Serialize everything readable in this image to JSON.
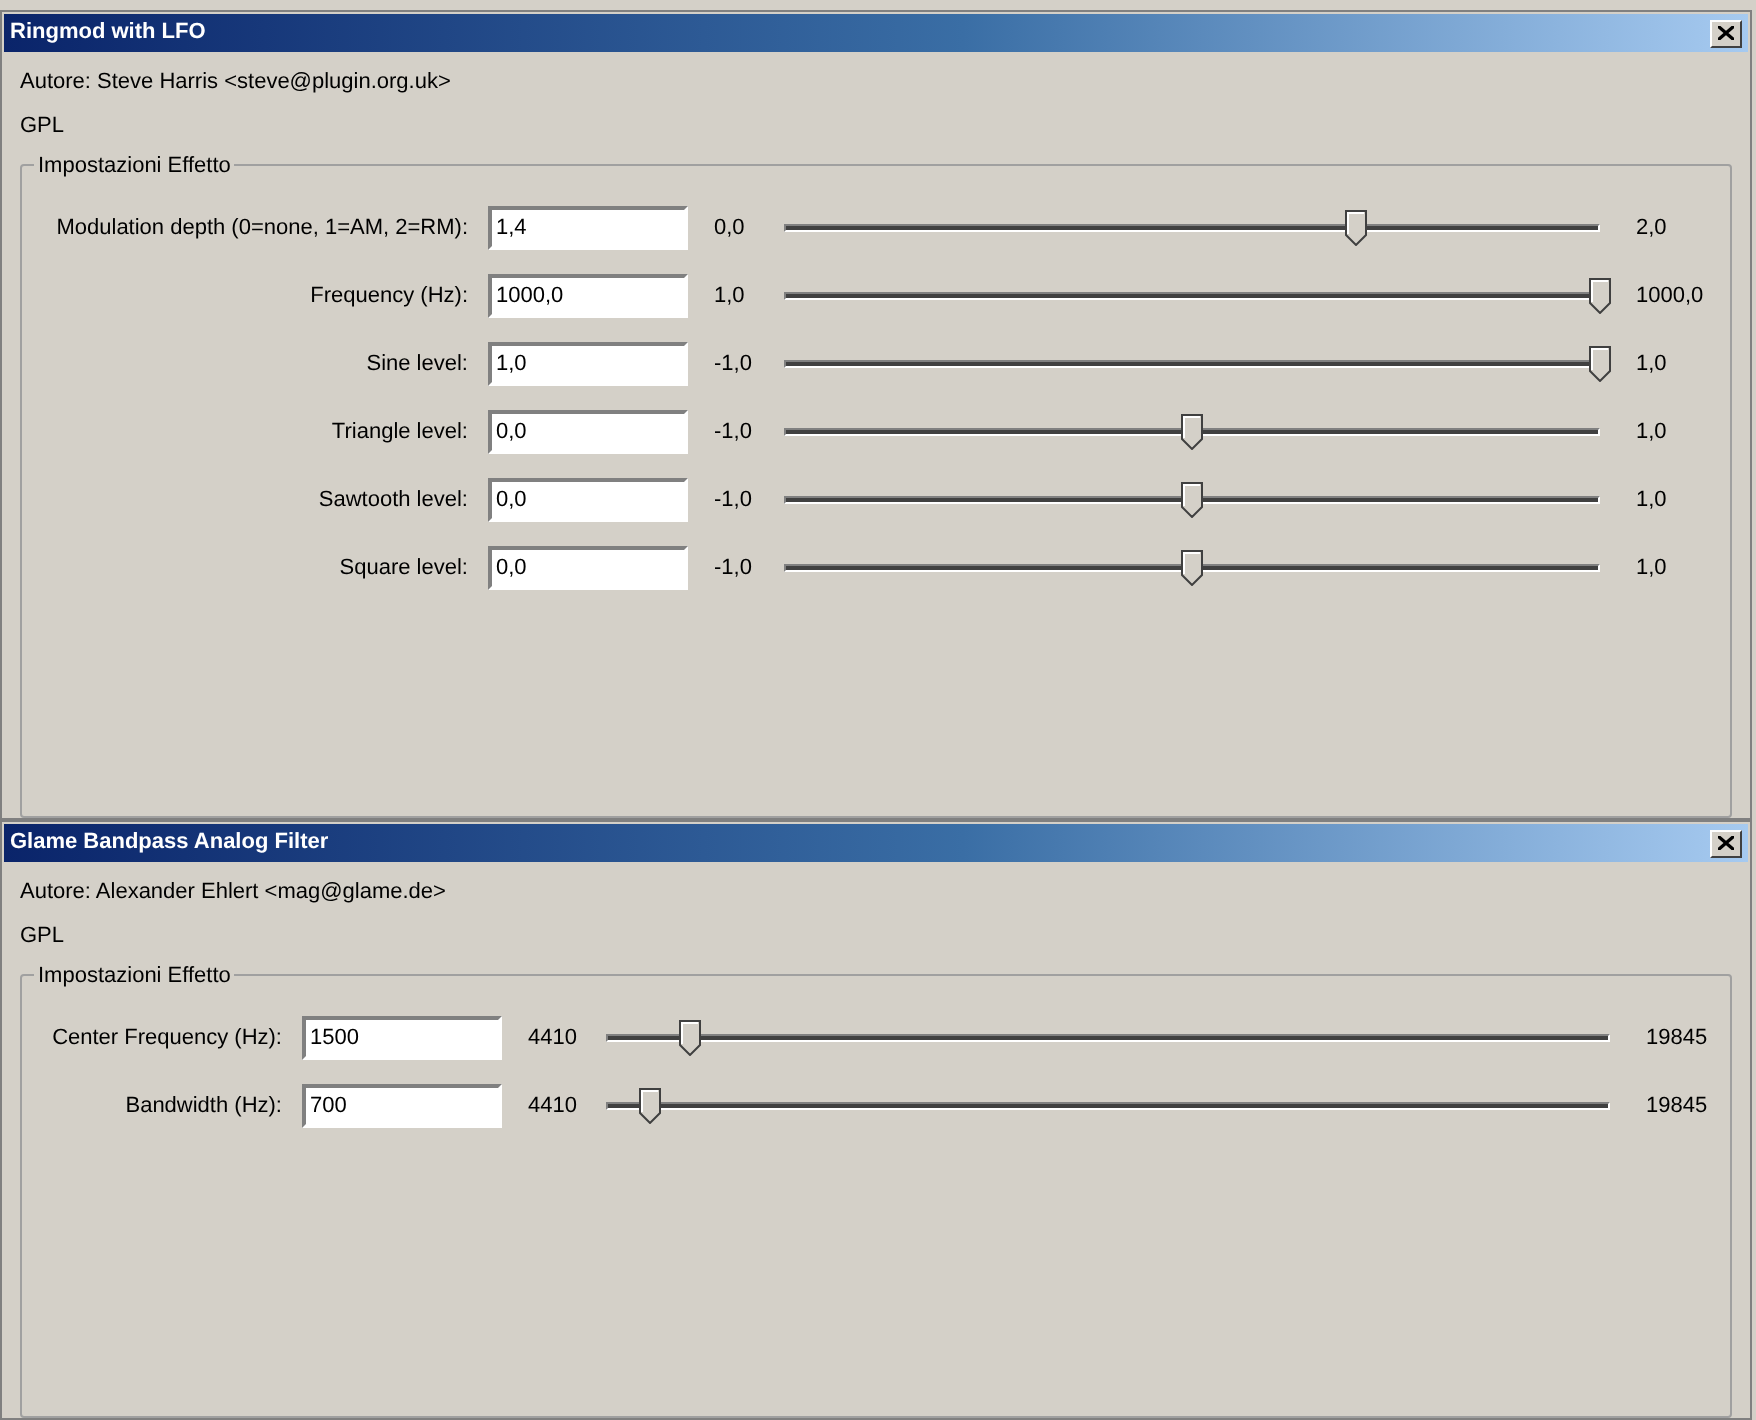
{
  "windows": [
    {
      "title": "Ringmod with LFO",
      "author": "Autore: Steve Harris <steve@plugin.org.uk>",
      "license": "GPL",
      "group_title": "Impostazioni Effetto",
      "params": [
        {
          "label": "Modulation depth (0=none, 1=AM, 2=RM):",
          "value": "1,4",
          "min": "0,0",
          "max": "2,0",
          "level": 0.7
        },
        {
          "label": "Frequency (Hz):",
          "value": "1000,0",
          "min": "1,0",
          "max": "1000,0",
          "level": 1.0
        },
        {
          "label": "Sine level:",
          "value": "1,0",
          "min": "-1,0",
          "max": "1,0",
          "level": 1.0
        },
        {
          "label": "Triangle level:",
          "value": "0,0",
          "min": "-1,0",
          "max": "1,0",
          "level": 0.5
        },
        {
          "label": "Sawtooth level:",
          "value": "0,0",
          "min": "-1,0",
          "max": "1,0",
          "level": 0.5
        },
        {
          "label": "Square level:",
          "value": "0,0",
          "min": "-1,0",
          "max": "1,0",
          "level": 0.5
        }
      ]
    },
    {
      "title": "Glame Bandpass Analog Filter",
      "author": "Autore: Alexander Ehlert <mag@glame.de>",
      "license": "GPL",
      "group_title": "Impostazioni Effetto",
      "params": [
        {
          "label": "Center Frequency (Hz):",
          "value": "1500",
          "min": "4410",
          "max": "19845",
          "level": 0.084
        },
        {
          "label": "Bandwidth (Hz):",
          "value": "700",
          "min": "4410",
          "max": "19845",
          "level": 0.044
        }
      ]
    }
  ]
}
